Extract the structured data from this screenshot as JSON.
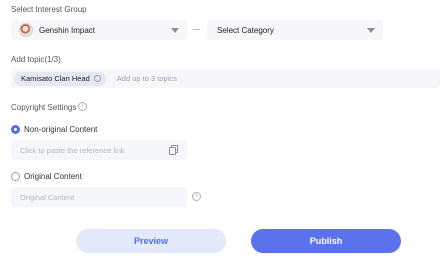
{
  "interest_group": {
    "label": "Select Interest Group",
    "game": "Genshin Impact",
    "category": "Select Category"
  },
  "topics": {
    "label": "Add topic(1/3)",
    "items": [
      {
        "label": "Kamisato Clan Head"
      }
    ],
    "placeholder": "Add up to 3 topics"
  },
  "copyright": {
    "label": "Copyright Settings",
    "non_original": {
      "label": "Non-original Content",
      "selected": true,
      "reference_placeholder": "Click to paste the reference link"
    },
    "original": {
      "label": "Original Content",
      "selected": false,
      "placeholder": "Original Content"
    }
  },
  "actions": {
    "preview_label": "Preview",
    "publish_label": "Publish"
  },
  "colors": {
    "accent": "#5a72ec",
    "accent_light": "#e3e8fb",
    "field_bg": "#f6f7fa"
  }
}
